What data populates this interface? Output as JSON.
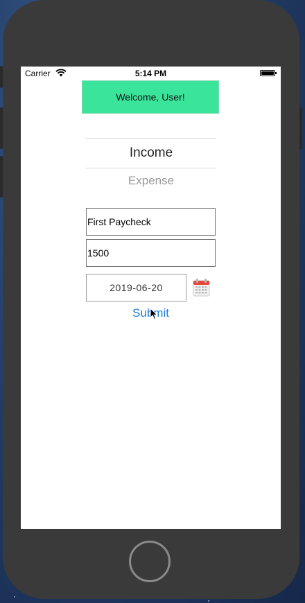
{
  "status_bar": {
    "carrier": "Carrier",
    "time": "5:14 PM"
  },
  "header": {
    "welcome_text": "Welcome, User!",
    "accent_color": "#3ae49a"
  },
  "segment": {
    "income_label": "Income",
    "expense_label": "Expense",
    "selected": "Income"
  },
  "form": {
    "name_value": "First Paycheck",
    "amount_value": "1500",
    "date_value": "2019-06-20",
    "submit_label": "Submit",
    "submit_color": "#1a7fe0"
  }
}
